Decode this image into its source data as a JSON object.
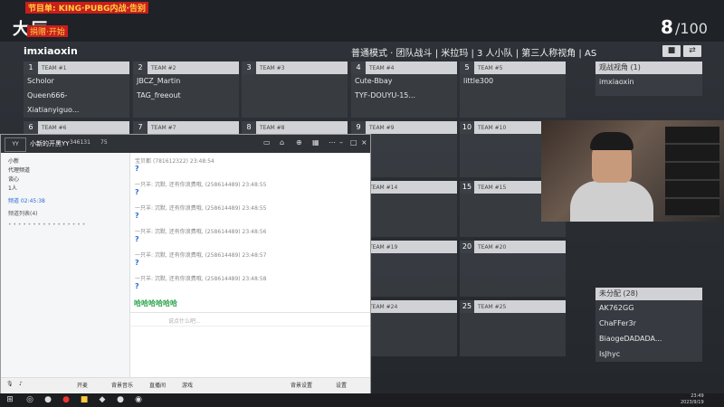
{
  "lobby": {
    "banner": "节目单: KING·PUBG内战·告别",
    "hall_title": "大厅",
    "hall_subtitle": "捐赠·开始",
    "counter_current": "8",
    "counter_total": "/100",
    "room_owner": "imxiaoxin",
    "mode_bar": "普通模式 · 团队战斗 | 米拉玛 | 3 人小队 | 第三人称视角 | AS",
    "teams": [
      {
        "num": "1",
        "label": "TEAM #1",
        "players": [
          "Scholor",
          "Queen666-",
          "Xiatianyiguo..."
        ]
      },
      {
        "num": "2",
        "label": "TEAM #2",
        "players": [
          "JBCZ_Martin",
          "TAG_freeout"
        ]
      },
      {
        "num": "3",
        "label": "TEAM #3",
        "players": []
      },
      {
        "num": "4",
        "label": "TEAM #4",
        "players": [
          "Cute-Bbay",
          "TYF-DOUYU-15..."
        ]
      },
      {
        "num": "5",
        "label": "TEAM #5",
        "players": [
          "little300"
        ]
      },
      {
        "num": "6",
        "label": "TEAM #6",
        "players": []
      },
      {
        "num": "7",
        "label": "TEAM #7",
        "players": []
      },
      {
        "num": "8",
        "label": "TEAM #8",
        "players": []
      },
      {
        "num": "9",
        "label": "TEAM #9",
        "players": []
      },
      {
        "num": "10",
        "label": "TEAM #10",
        "players": []
      },
      {
        "num": "14",
        "label": "TEAM #14",
        "players": []
      },
      {
        "num": "15",
        "label": "TEAM #15",
        "players": []
      },
      {
        "num": "19",
        "label": "TEAM #19",
        "players": []
      },
      {
        "num": "20",
        "label": "TEAM #20",
        "players": []
      },
      {
        "num": "24",
        "label": "TEAM #24",
        "players": []
      },
      {
        "num": "25",
        "label": "TEAM #25",
        "players": []
      }
    ],
    "spectate": {
      "title": "观战视角 (1)",
      "players": [
        "imxiaoxin"
      ]
    },
    "unassigned": {
      "title": "未分配 (28)",
      "players": [
        "AK762GG",
        "ChaFFer3r",
        "BiaogeDADADA...",
        "IsJhyc"
      ]
    }
  },
  "chat": {
    "room_name": "小新的开黑YY",
    "room_id": "346131",
    "online": "75",
    "sidebar_rows": [
      "小新",
      "代理频道",
      "谈心",
      "1人",
      "频道 02:45:38"
    ],
    "member_header": "频道列表(4)",
    "messages": [
      {
        "user": "宝贝都",
        "meta": "(781612322) 23:48:54",
        "text": "?"
      },
      {
        "user": "一只羊: 沉默, 还有你浪费哦,",
        "meta": "(258614489) 23:48:55",
        "text": "?"
      },
      {
        "user": "一只羊: 沉默, 还有你浪费哦,",
        "meta": "(258614489) 23:48:55",
        "text": "?"
      },
      {
        "user": "一只羊: 沉默, 还有你浪费哦,",
        "meta": "(258614489) 23:48:56",
        "text": "?"
      },
      {
        "user": "一只羊: 沉默, 还有你浪费哦,",
        "meta": "(258614489) 23:48:57",
        "text": "?"
      },
      {
        "user": "一只羊: 沉默, 还有你浪费哦,",
        "meta": "(258614489) 23:48:58",
        "text": "?"
      }
    ],
    "laugh": "哈哈哈哈哈哈",
    "input_placeholder": "说点什么吧...",
    "bottom_items": [
      "开麦",
      "背景音乐",
      "直播间",
      "游戏",
      "背景设置",
      "设置"
    ]
  },
  "taskbar": {
    "time": "23:49",
    "date": "2023/9/19"
  }
}
